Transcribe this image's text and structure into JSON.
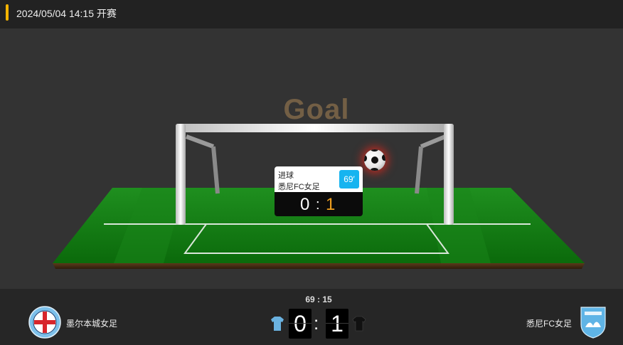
{
  "header": {
    "datetime_status": "2024/05/04 14:15 开赛"
  },
  "animation": {
    "title": "Goal",
    "event": {
      "type": "进球",
      "team": "悉尼FC女足",
      "minute": "69′",
      "score_home": "0",
      "score_sep": ":",
      "score_away": "1"
    }
  },
  "match": {
    "clock": "69 : 15",
    "home": {
      "name": "墨尔本城女足",
      "score": "0",
      "shirt_color": "#6ab2e0",
      "logo_ring_text": "MELBOURNE CITY"
    },
    "away": {
      "name": "悉尼FC女足",
      "score": "1",
      "shirt_color": "#111111",
      "logo_text": "SYDNEY FC"
    },
    "score_sep": ":"
  },
  "colors": {
    "accent": "#f5b400",
    "goal_title": "#735f45",
    "minute_badge": "#16b4f0",
    "away_score_highlight": "#f0a020"
  }
}
